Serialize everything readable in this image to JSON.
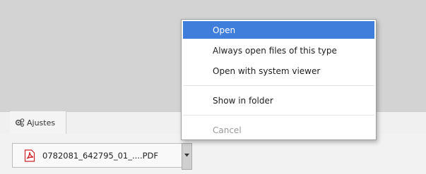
{
  "tabs": {
    "settings_label": "Ajustes",
    "settings_icon": "gears-icon"
  },
  "download": {
    "filename": "0782081_642795_01_....PDF",
    "file_icon": "pdf-icon",
    "dropdown_icon": "chevron-down-icon"
  },
  "context_menu": {
    "items": [
      {
        "label": "Open"
      },
      {
        "label": "Always open files of this type"
      },
      {
        "label": "Open with system viewer"
      },
      {
        "label": "Show in folder"
      },
      {
        "label": "Cancel"
      }
    ]
  },
  "colors": {
    "highlight": "#3f7edb",
    "pdf_red": "#d6232a"
  }
}
